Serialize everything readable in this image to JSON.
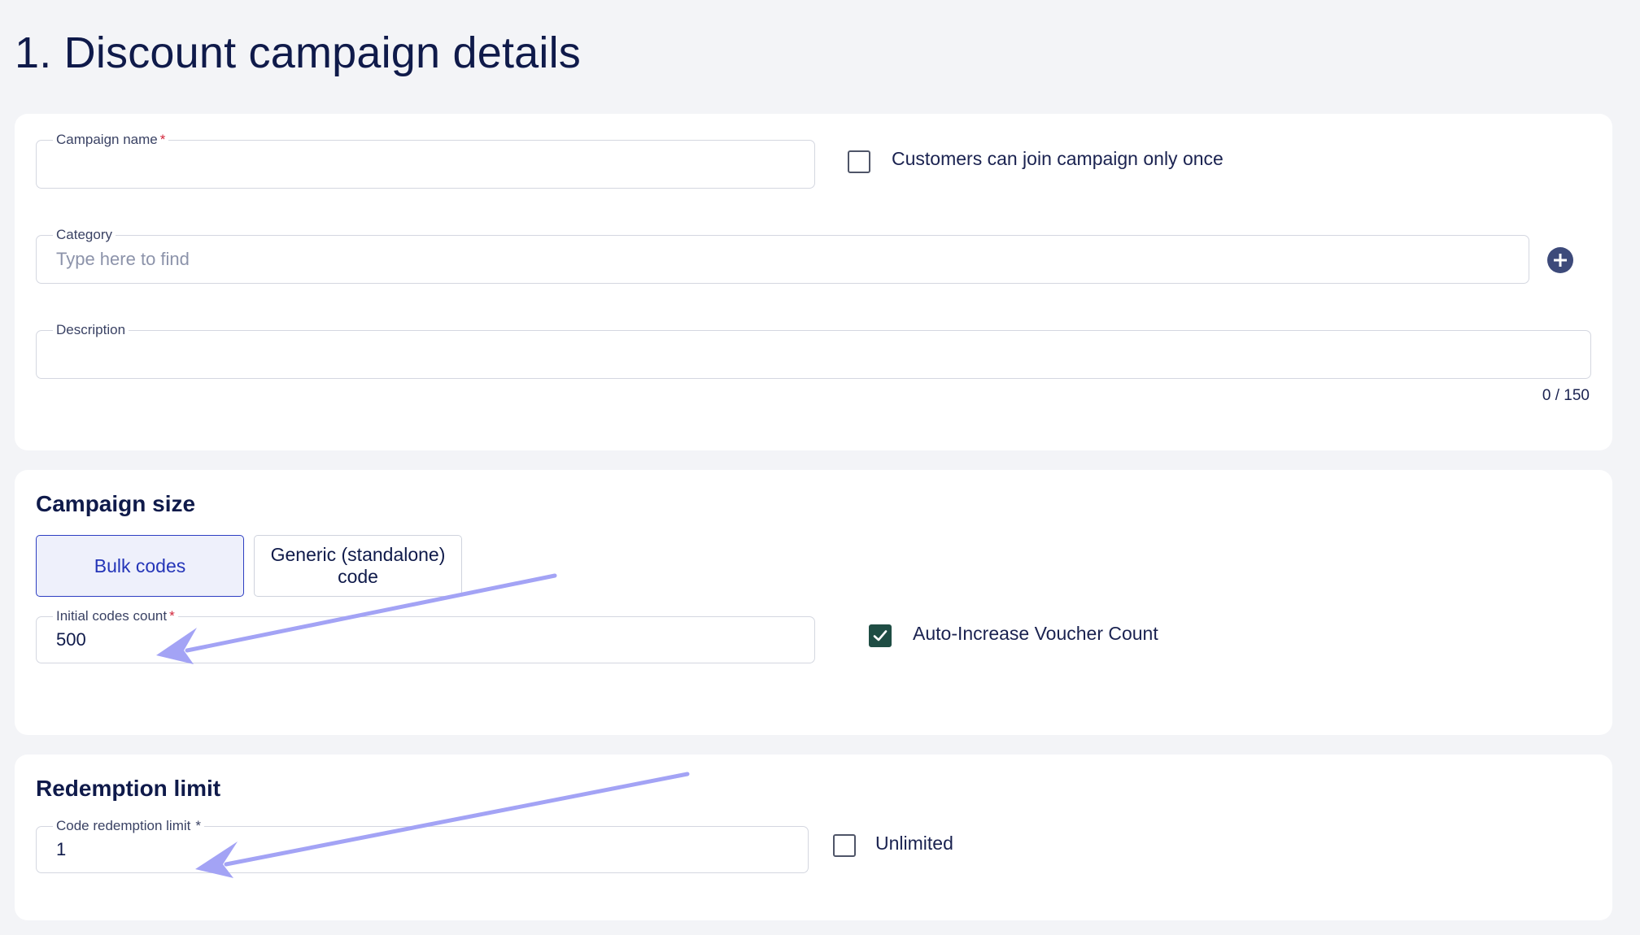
{
  "page_title": "1. Discount campaign details",
  "details": {
    "campaign_name": {
      "label": "Campaign name",
      "required_mark": "*",
      "value": ""
    },
    "join_once": {
      "label": "Customers can join campaign only once",
      "checked": false
    },
    "category": {
      "label": "Category",
      "placeholder": "Type here to find",
      "value": ""
    },
    "add_category_icon": "plus-circle-icon",
    "description": {
      "label": "Description",
      "value": "",
      "counter": "0 / 150"
    }
  },
  "campaign_size": {
    "title": "Campaign size",
    "options": [
      "Bulk codes",
      "Generic (standalone) code"
    ],
    "selected": "Bulk codes",
    "initial_codes": {
      "label": "Initial codes count",
      "required_mark": "*",
      "value": "500"
    },
    "auto_increase": {
      "label": "Auto-Increase Voucher Count",
      "checked": true
    }
  },
  "redemption_limit": {
    "title": "Redemption limit",
    "code_limit": {
      "label": "Code redemption limit",
      "required_mark": "*",
      "value": "1"
    },
    "unlimited": {
      "label": "Unlimited",
      "checked": false
    }
  },
  "colors": {
    "title": "#0f1a4a",
    "accent": "#2435b8",
    "required": "#d2263a",
    "checkbox_checked": "#1f4d44",
    "annotation_arrow": "#a3a3f5"
  }
}
